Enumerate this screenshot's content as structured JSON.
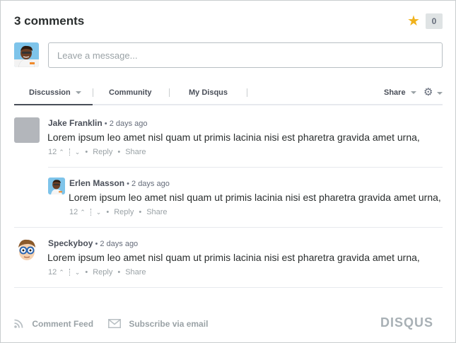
{
  "header": {
    "comment_count": "3 comments",
    "recommend_count": "0"
  },
  "composer": {
    "placeholder": "Leave a message..."
  },
  "nav": {
    "tabs": [
      {
        "label": "Discussion"
      },
      {
        "label": "Community"
      },
      {
        "label": "My Disqus"
      }
    ],
    "share_label": "Share"
  },
  "comments": [
    {
      "author": "Jake Franklin",
      "time": "2 days ago",
      "body": "Lorem ipsum leo amet nisl quam ut primis lacinia nisi est pharetra gravida amet urna,",
      "votes": "12",
      "reply": "Reply",
      "share": "Share",
      "avatar": "gray-placeholder"
    },
    {
      "author": "Erlen Masson",
      "time": "2 days ago",
      "body": "Lorem ipsum leo amet nisl quam ut primis lacinia nisi est pharetra gravida amet urna,",
      "votes": "12",
      "reply": "Reply",
      "share": "Share",
      "avatar": "person-avatar"
    },
    {
      "author": "Speckyboy",
      "time": "2 days ago",
      "body": "Lorem ipsum leo amet nisl quam ut primis lacinia nisi est pharetra gravida amet urna,",
      "votes": "12",
      "reply": "Reply",
      "share": "Share",
      "avatar": "glasses-cartoon-avatar"
    }
  ],
  "footer": {
    "feed_label": "Comment Feed",
    "subscribe_label": "Subscribe via email",
    "brand": "DISQUS"
  },
  "colors": {
    "star": "#f0b21c",
    "text": "#2a2e2e",
    "muted": "#9aa2a6",
    "logo": "#a8b0b5"
  },
  "icons": [
    "star-icon",
    "gear-icon",
    "rss-icon",
    "mail-icon",
    "chevron-up-icon",
    "chevron-down-icon"
  ]
}
